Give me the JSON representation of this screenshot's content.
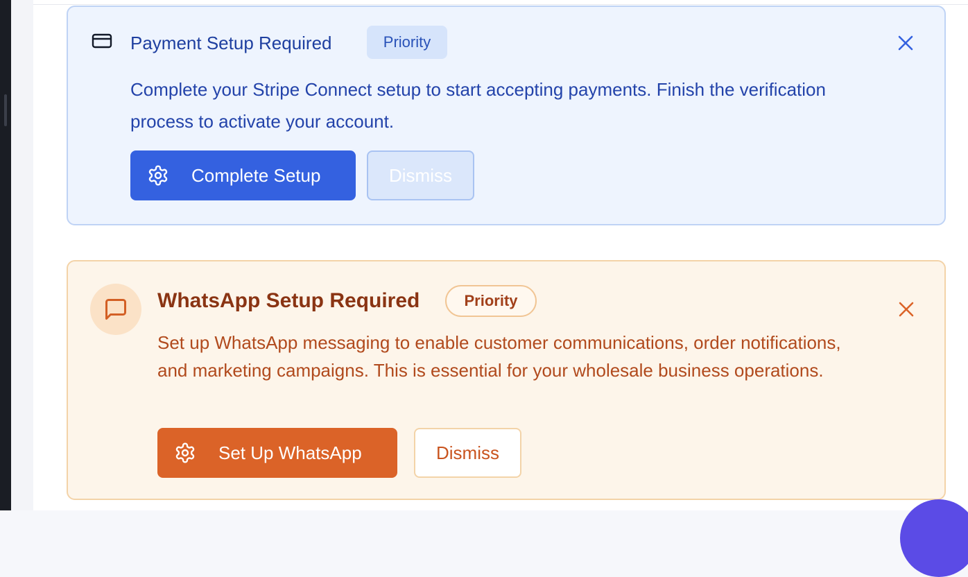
{
  "payment_banner": {
    "title": "Payment Setup Required",
    "badge": "Priority",
    "description": "Complete your Stripe Connect setup to start accepting payments. Finish the verification process to activate your account.",
    "primary_button": "Complete Setup",
    "dismiss_button": "Dismiss",
    "icon": "credit-card-icon",
    "accent_color": "#3461e0"
  },
  "whatsapp_banner": {
    "title": "WhatsApp Setup Required",
    "badge": "Priority",
    "description": "Set up WhatsApp messaging to enable customer communications, order notifications, and marketing campaigns. This is essential for your wholesale business operations.",
    "primary_button": "Set Up WhatsApp",
    "dismiss_button": "Dismiss",
    "icon": "message-square-icon",
    "accent_color": "#db6328"
  }
}
